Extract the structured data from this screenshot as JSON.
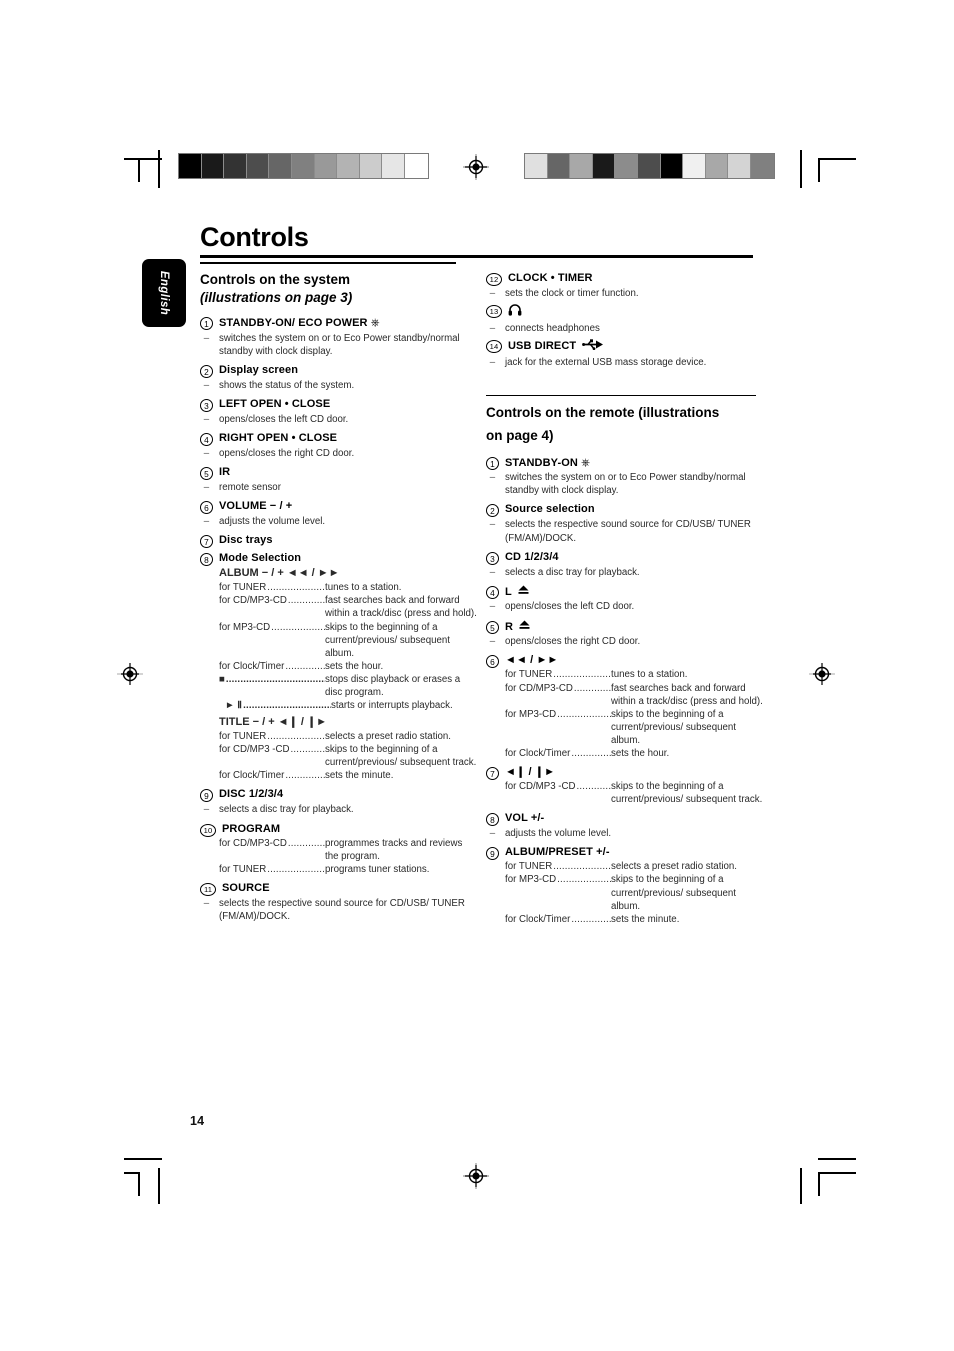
{
  "page": {
    "title": "Controls",
    "number": "14",
    "language_tab": "English"
  },
  "print_marks": {
    "gray_strip_left": [
      "#000000",
      "#1a1a1a",
      "#333333",
      "#4d4d4d",
      "#666666",
      "#808080",
      "#999999",
      "#b3b3b3",
      "#cccccc",
      "#e6e6e6",
      "#ffffff"
    ],
    "gray_strip_right": [
      "#e0e0e0",
      "#666666",
      "#a8a8a8",
      "#1a1a1a",
      "#8c8c8c",
      "#4d4d4d",
      "#000000",
      "#f0f0f0",
      "#a8a8a8",
      "#d4d4d4",
      "#808080"
    ]
  },
  "left_column": {
    "section_heading_line1": "Controls on the system",
    "section_heading_line2": "(illustrations on page 3)",
    "entries": [
      {
        "num": "1",
        "title": "STANDBY-ON/ ECO POWER",
        "glyph": "power",
        "desc": "switches the system on or to Eco Power standby/normal standby with clock display."
      },
      {
        "num": "2",
        "title": "Display screen",
        "desc": "shows the status of the system."
      },
      {
        "num": "3",
        "title": "LEFT OPEN • CLOSE",
        "desc": "opens/closes the left CD door."
      },
      {
        "num": "4",
        "title": "RIGHT OPEN • CLOSE",
        "desc": "opens/closes the right CD door."
      },
      {
        "num": "5",
        "title": "IR",
        "desc": "remote sensor"
      },
      {
        "num": "6",
        "title": "VOLUME − / +",
        "desc": "adjusts the volume level."
      },
      {
        "num": "7",
        "title": "Disc trays"
      },
      {
        "num": "8",
        "title": "Mode Selection",
        "sub_title_1": "ALBUM − / +  ◄◄ / ►►",
        "rows_1": [
          {
            "label": "for TUNER",
            "text": "tunes to a station."
          },
          {
            "label": "for CD/MP3-CD",
            "text": "fast searches back and forward within a track/disc (press and hold)."
          },
          {
            "label": "for MP3-CD",
            "text": "skips to the beginning of a current/previous/ subsequent album."
          },
          {
            "label": "for Clock/Timer",
            "text": "sets the hour."
          },
          {
            "label": "■",
            "is_icon": true,
            "text": "stops disc playback or erases a disc program."
          },
          {
            "label": "► Ⅱ",
            "is_icon": true,
            "text": "starts or interrupts playback."
          }
        ],
        "sub_title_2": "TITLE − / + ◄❙ / ❙►",
        "rows_2": [
          {
            "label": "for TUNER",
            "text": "selects a preset radio station."
          },
          {
            "label": "for CD/MP3 -CD",
            "text": "skips to the beginning of a current/previous/ subsequent track."
          },
          {
            "label": "for Clock/Timer",
            "text": "sets the minute."
          }
        ]
      },
      {
        "num": "9",
        "title": "DISC 1/2/3/4",
        "desc": "selects a disc tray for playback."
      },
      {
        "num": "10",
        "title": "PROGRAM",
        "rows_1": [
          {
            "label": "for CD/MP3-CD",
            "text": "programmes tracks and reviews the program."
          },
          {
            "label": "for TUNER",
            "text": "programs tuner stations."
          }
        ]
      },
      {
        "num": "11",
        "title": "SOURCE",
        "desc": "selects the respective sound source for CD/USB/ TUNER (FM/AM)/DOCK."
      }
    ]
  },
  "right_column": {
    "entries_system": [
      {
        "num": "12",
        "title": "CLOCK • TIMER",
        "desc": "sets the clock or timer function."
      },
      {
        "num": "13",
        "title": "",
        "glyph": "headphones",
        "desc": "connects headphones"
      },
      {
        "num": "14",
        "title": "USB DIRECT",
        "glyph": "usb",
        "desc": "jack for the external USB mass storage device."
      }
    ],
    "section_heading": "Controls on the remote",
    "section_heading_italic_1": "(illustrations",
    "section_heading_italic_2": "on page 4)",
    "entries_remote": [
      {
        "num": "1",
        "title": "STANDBY-ON",
        "glyph": "power",
        "desc": "switches the system on or to Eco Power standby/normal standby with clock display."
      },
      {
        "num": "2",
        "title": "Source selection",
        "desc": "selects the respective sound source for CD/USB/ TUNER (FM/AM)/DOCK."
      },
      {
        "num": "3",
        "title": "CD 1/2/3/4",
        "desc": "selects a disc tray for playback."
      },
      {
        "num": "4",
        "title": "L",
        "glyph": "eject",
        "desc": "opens/closes the left CD door."
      },
      {
        "num": "5",
        "title": "R",
        "glyph": "eject",
        "desc": "opens/closes the right CD door."
      },
      {
        "num": "6",
        "title": "◄◄ / ►►",
        "rows_1": [
          {
            "label": "for TUNER",
            "text": "tunes to a station."
          },
          {
            "label": "for CD/MP3-CD",
            "text": "fast searches back and forward within a track/disc (press and hold)."
          },
          {
            "label": "for MP3-CD",
            "text": "skips to the beginning of a current/previous/ subsequent album."
          },
          {
            "label": "for Clock/Timer",
            "text": "sets the hour."
          }
        ]
      },
      {
        "num": "7",
        "title": "◄❙ / ❙►",
        "rows_1": [
          {
            "label": "for CD/MP3 -CD",
            "text": "skips to the beginning of a current/previous/ subsequent track."
          }
        ]
      },
      {
        "num": "8",
        "title": "VOL +/-",
        "desc": "adjusts the volume level."
      },
      {
        "num": "9",
        "title": "ALBUM/PRESET +/-",
        "rows_1": [
          {
            "label": "for TUNER",
            "text": "selects a preset radio station."
          },
          {
            "label": "for MP3-CD",
            "text": "skips to the beginning of a current/previous/ subsequent album."
          },
          {
            "label": "for Clock/Timer",
            "text": "sets the minute."
          }
        ]
      }
    ]
  }
}
